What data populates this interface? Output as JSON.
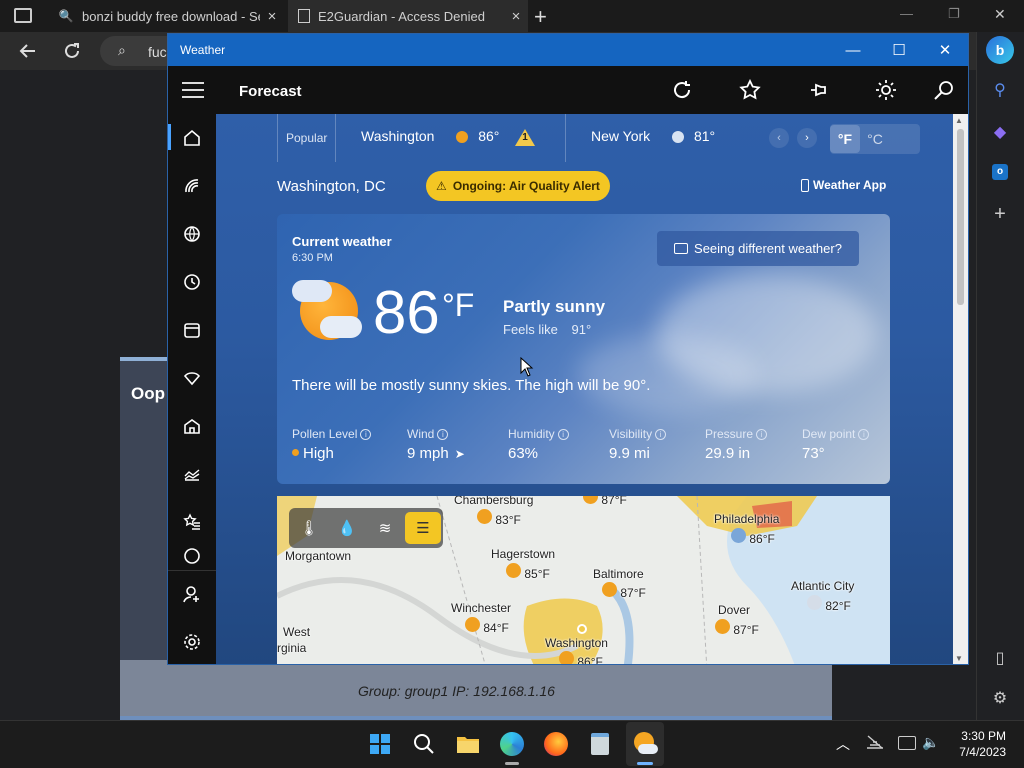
{
  "browser": {
    "tabs": [
      {
        "title": "bonzi buddy free download - Se",
        "close": "×"
      },
      {
        "title": "E2Guardian - Access Denied",
        "close": "×"
      }
    ],
    "new_tab": "+",
    "address_partial": "fuc",
    "window_controls": {
      "minimize": "—",
      "restore": "❐",
      "close": "✕"
    }
  },
  "blocked_page": {
    "title": "Oop",
    "footer": "Group: group1   IP: 192.168.1.16"
  },
  "weather_app": {
    "window_title": "Weather",
    "header_title": "Forecast",
    "toolbar_icons": [
      "refresh-icon",
      "favorite-star-icon",
      "pin-icon",
      "brightness-icon",
      "search-icon"
    ],
    "nav_icons": [
      "home-icon",
      "radar-icon",
      "globe-icon",
      "history-icon",
      "calendar-icon",
      "lifestyle-icon",
      "home-property-icon",
      "trends-icon",
      "favorites-icon",
      "more-icon",
      "account-icon",
      "settings-icon"
    ],
    "locations_strip": {
      "popular_label": "Popular",
      "locations": [
        {
          "name": "Washington",
          "temp": "86°",
          "alert_count": "1"
        },
        {
          "name": "New York",
          "temp": "81°"
        }
      ],
      "units": [
        "°F",
        "°C"
      ],
      "selected_unit": "°F"
    },
    "city": "Washington, DC",
    "alert_text": "Ongoing: Air Quality Alert",
    "weather_app_link": "Weather App",
    "current": {
      "label": "Current weather",
      "time": "6:30 PM",
      "seeing_different": "Seeing different weather?",
      "temp": "86",
      "unit": "°F",
      "condition": "Partly sunny",
      "feels_like_label": "Feels like",
      "feels_like_value": "91°",
      "summary": "There will be mostly sunny skies. The high will be 90°.",
      "metrics": [
        {
          "label": "Pollen Level",
          "value": "High"
        },
        {
          "label": "Wind",
          "value": "9 mph"
        },
        {
          "label": "Humidity",
          "value": "63%"
        },
        {
          "label": "Visibility",
          "value": "9.9 mi"
        },
        {
          "label": "Pressure",
          "value": "29.9 in"
        },
        {
          "label": "Dew point",
          "value": "73°"
        }
      ]
    },
    "map": {
      "tools": [
        "temperature-icon",
        "precipitation-icon",
        "wind-icon",
        "air-quality-icon"
      ],
      "labels": [
        {
          "name": "Chambersburg",
          "temp": "83°F"
        },
        {
          "name": "",
          "temp": "87°F"
        },
        {
          "name": "Philadelphia",
          "temp": "86°F"
        },
        {
          "name": "Morgantown",
          "temp": ""
        },
        {
          "name": "Hagerstown",
          "temp": "85°F"
        },
        {
          "name": "Baltimore",
          "temp": "87°F"
        },
        {
          "name": "Atlantic City",
          "temp": "82°F"
        },
        {
          "name": "Winchester",
          "temp": "84°F"
        },
        {
          "name": "Dover",
          "temp": "87°F"
        },
        {
          "name": "West",
          "temp": ""
        },
        {
          "name": "rginia",
          "temp": ""
        },
        {
          "name": "Washington",
          "temp": "86°F"
        }
      ]
    }
  },
  "taskbar": {
    "apps": [
      "windows-start-icon",
      "search-icon",
      "file-explorer-icon",
      "edge-icon",
      "firefox-icon",
      "notepad-icon",
      "weather-app-icon"
    ],
    "time": "3:30 PM",
    "date": "7/4/2023"
  },
  "colors": {
    "accent": "#1565c0",
    "alert": "#f3c623",
    "content_bg": "#2c5aa1"
  }
}
